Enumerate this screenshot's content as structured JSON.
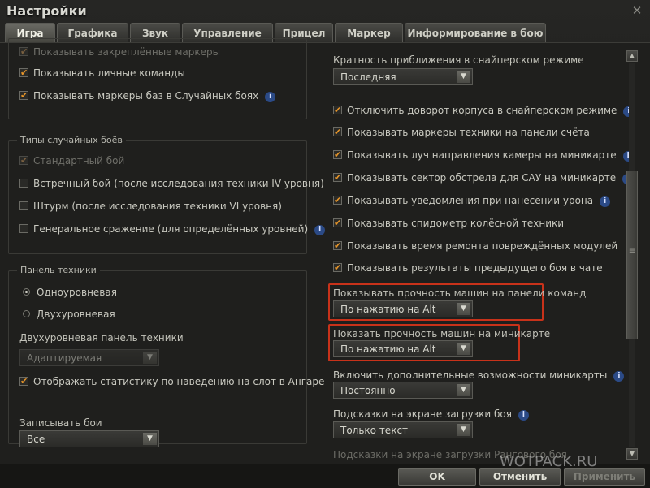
{
  "window": {
    "title": "Настройки"
  },
  "tabs": [
    {
      "label": "Игра",
      "active": true
    },
    {
      "label": "Графика"
    },
    {
      "label": "Звук"
    },
    {
      "label": "Управление"
    },
    {
      "label": "Прицел"
    },
    {
      "label": "Маркер"
    },
    {
      "label": "Информирование в бою"
    }
  ],
  "left": {
    "top_rows": [
      {
        "label": "Показывать закреплённые маркеры",
        "checked": true
      },
      {
        "label": "Показывать личные команды",
        "checked": true
      },
      {
        "label": "Показывать маркеры баз в Случайных боях",
        "checked": true,
        "info": true
      }
    ],
    "battle_types": {
      "title": "Типы случайных боёв",
      "items": [
        {
          "label": "Стандартный бой",
          "checked": true,
          "disabled": true
        },
        {
          "label": "Встречный бой (после исследования техники IV уровня)",
          "checked": false
        },
        {
          "label": "Штурм (после исследования техники VI уровня)",
          "checked": false
        },
        {
          "label": "Генеральное сражение (для определённых уровней)",
          "checked": false,
          "info": true
        }
      ]
    },
    "vehicle_panel": {
      "title": "Панель техники",
      "radio": [
        {
          "label": "Одноуровневая",
          "selected": true
        },
        {
          "label": "Двухуровневая",
          "selected": false
        }
      ],
      "two_level_label": "Двухуровневая панель техники",
      "two_level_value": "Адаптируемая",
      "hangar_stats": {
        "label": "Отображать статистику по наведению на слот в Ангаре",
        "checked": true
      }
    },
    "record": {
      "label": "Записывать бои",
      "value": "Все"
    }
  },
  "right": {
    "zoom": {
      "label": "Кратность приближения в снайперском режиме",
      "value": "Последняя"
    },
    "checks": [
      {
        "label": "Отключить доворот корпуса в снайперском режиме",
        "checked": true,
        "info": true
      },
      {
        "label": "Показывать маркеры техники на панели счёта",
        "checked": true
      },
      {
        "label": "Показывать луч направления камеры на миникарте",
        "checked": true,
        "info": true
      },
      {
        "label": "Показывать сектор обстрела для САУ на миникарте",
        "checked": true,
        "info": true
      },
      {
        "label": "Показывать уведомления при нанесении урона",
        "checked": true,
        "info": true
      },
      {
        "label": "Показывать спидометр колёсной техники",
        "checked": true
      },
      {
        "label": "Показывать время ремонта повреждённых модулей",
        "checked": true
      },
      {
        "label": "Показывать результаты предыдущего боя в чате",
        "checked": true
      }
    ],
    "team_hp": {
      "label": "Показывать прочность машин на панели команд",
      "value": "По нажатию на Alt"
    },
    "minimap_hp": {
      "label": "Показать прочность машин на миникарте",
      "value": "По нажатию на Alt"
    },
    "minimap_extra": {
      "label": "Включить дополнительные возможности миникарты",
      "value": "Постоянно",
      "info": true
    },
    "loading_tips": {
      "label": "Подсказки на экране загрузки боя",
      "value": "Только текст",
      "info": true
    },
    "ranked_tips": {
      "label": "Подсказки на экране загрузки Рангового боя"
    }
  },
  "footer": {
    "ok": "OK",
    "cancel": "Отменить",
    "apply": "Применить"
  },
  "watermark": "WOTPACK.RU",
  "colors": {
    "accent_check": "#e8962a",
    "highlight": "#c8321a",
    "info": "#2b4a86"
  }
}
